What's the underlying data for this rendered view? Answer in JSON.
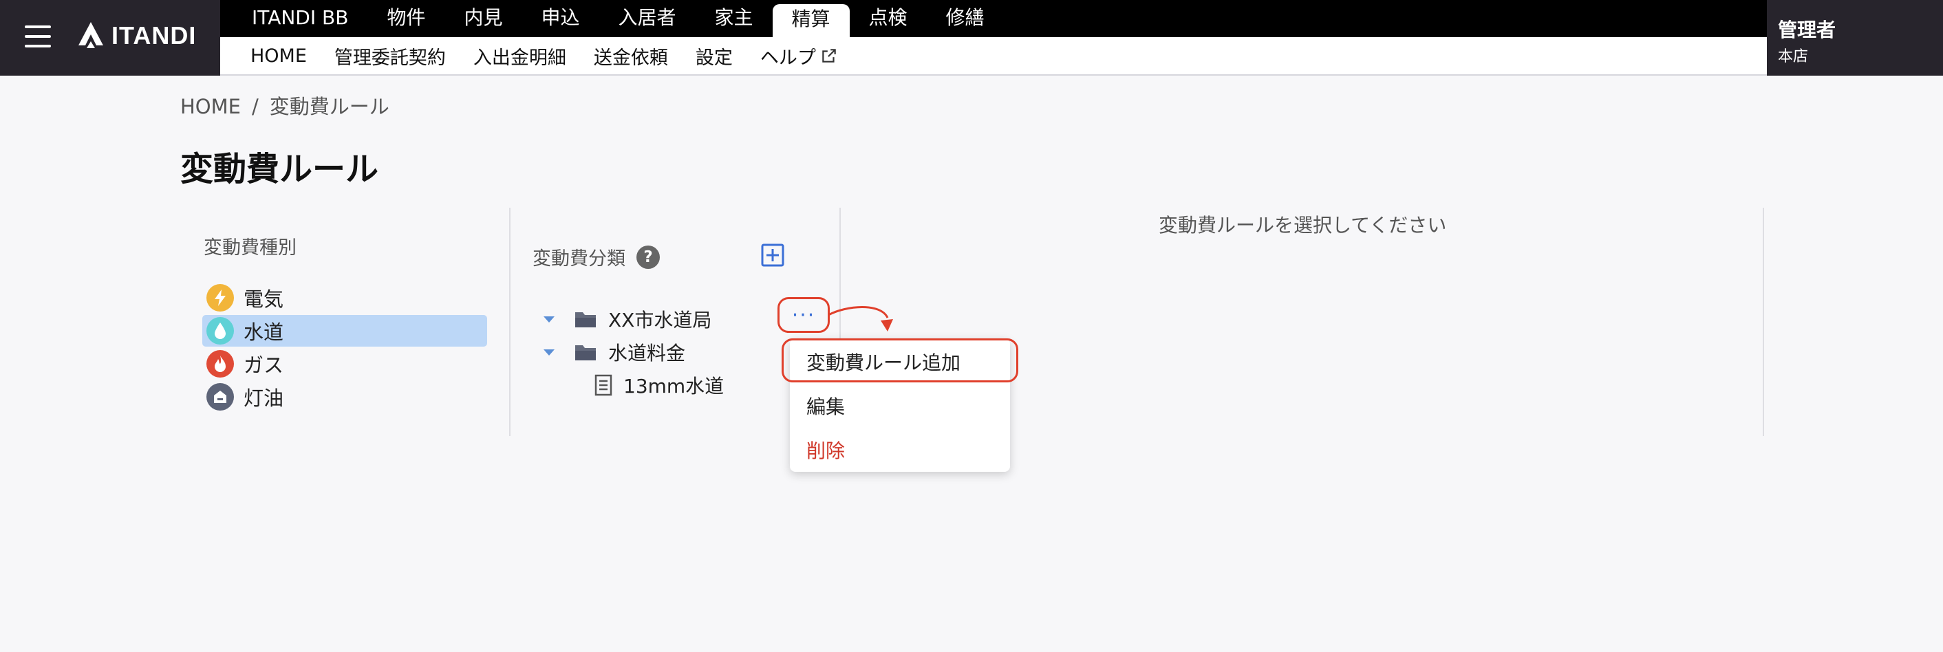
{
  "brand": {
    "name": "ITANDI"
  },
  "main_nav": [
    {
      "label": "ITANDI BB",
      "active": false
    },
    {
      "label": "物件",
      "active": false
    },
    {
      "label": "内見",
      "active": false
    },
    {
      "label": "申込",
      "active": false
    },
    {
      "label": "入居者",
      "active": false
    },
    {
      "label": "家主",
      "active": false
    },
    {
      "label": "精算",
      "active": true
    },
    {
      "label": "点検",
      "active": false
    },
    {
      "label": "修繕",
      "active": false
    }
  ],
  "sub_nav": [
    {
      "label": "HOME"
    },
    {
      "label": "管理委託契約"
    },
    {
      "label": "入出金明細"
    },
    {
      "label": "送金依頼"
    },
    {
      "label": "設定"
    },
    {
      "label": "ヘルプ"
    }
  ],
  "user": {
    "role": "管理者",
    "branch": "本店"
  },
  "breadcrumb": {
    "home": "HOME",
    "separator": "/",
    "current": "変動費ルール"
  },
  "page_title": "変動費ルール",
  "type_panel": {
    "title": "変動費種別",
    "items": [
      {
        "label": "電気",
        "icon": "lightning-icon",
        "color": "#f2b53a",
        "selected": false
      },
      {
        "label": "水道",
        "icon": "water-drop-icon",
        "color": "#5fd1d6",
        "selected": true
      },
      {
        "label": "ガス",
        "icon": "flame-icon",
        "color": "#e04a36",
        "selected": false
      },
      {
        "label": "灯油",
        "icon": "heater-icon",
        "color": "#5d6478",
        "selected": false
      }
    ]
  },
  "category_panel": {
    "title": "変動費分類",
    "help": "?",
    "tree": [
      {
        "label": "XX市水道局",
        "type": "folder"
      },
      {
        "label": "水道料金",
        "type": "folder"
      },
      {
        "label": "13mm水道",
        "type": "rule"
      }
    ],
    "more_label": "···",
    "context_menu": [
      {
        "label": "変動費ルール追加",
        "highlighted": true
      },
      {
        "label": "編集"
      },
      {
        "label": "削除",
        "danger": true
      }
    ]
  },
  "detail_panel": {
    "placeholder": "変動費ルールを選択してください"
  },
  "colors": {
    "accent": "#3b6fd6",
    "annotation": "#e0402c",
    "selected_bg": "#bcd7f7",
    "header_bg": "#27242c"
  }
}
